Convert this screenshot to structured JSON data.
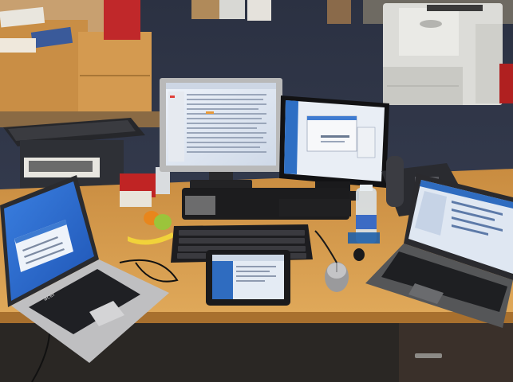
{
  "scene": {
    "description_free": true,
    "colors": {
      "carpet": "#33384a",
      "desk": "#d49a4a",
      "desk_dark": "#a8702e",
      "cabinet_wood": "#c98e45",
      "monitor_frame": "#1b1b1d",
      "silver": "#b9b9b9",
      "screen_blue": "#3e7bd1",
      "screen_white": "#f2f4f7",
      "copier": "#dcdcd8",
      "banana": "#f1d23a",
      "orange": "#e8861c",
      "apple": "#9bc43b"
    },
    "icons": [
      "laptop-acer-icon",
      "laptop-right-icon",
      "monitor-center-icon",
      "monitor-right-icon",
      "tablet-icon",
      "keyboard-icon",
      "mouse-icon",
      "phone-icon",
      "water-bottle-icon",
      "copier-icon"
    ]
  }
}
